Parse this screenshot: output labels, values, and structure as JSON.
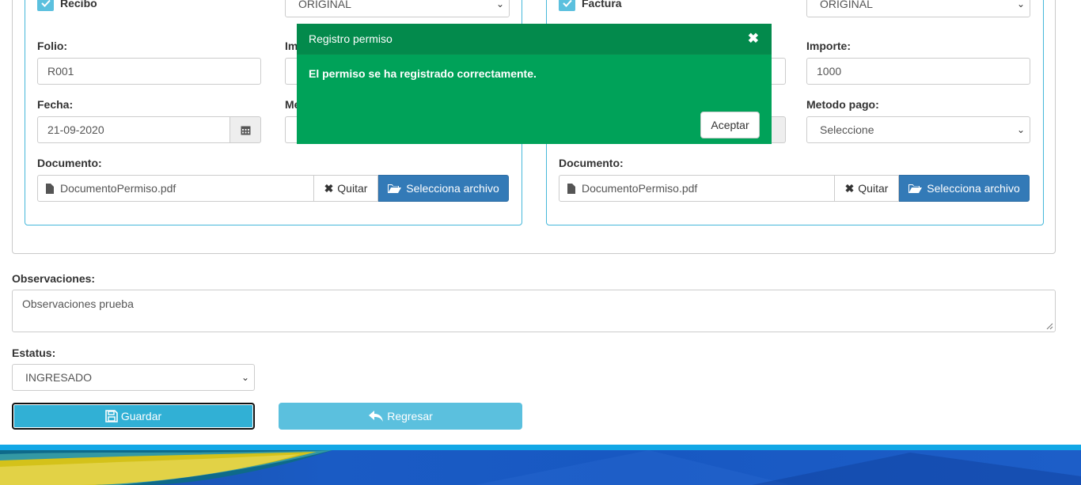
{
  "left_panel": {
    "checkbox_label": "Recibo",
    "type_select": "ORIGINAL",
    "folio_label": "Folio:",
    "folio_value": "R001",
    "importe_label_partial": "Im",
    "fecha_label": "Fecha:",
    "fecha_value": "21-09-2020",
    "metodo_label_partial": "Me",
    "documento_label": "Documento:",
    "file_name": "DocumentoPermiso.pdf",
    "remove_label": "Quitar",
    "select_file_label": "Selecciona archivo"
  },
  "right_panel": {
    "checkbox_label": "Factura",
    "type_select": "ORIGINAL",
    "importe_label": "Importe:",
    "importe_value": "1000",
    "metodo_label": "Metodo pago:",
    "metodo_value": "Seleccione",
    "documento_label": "Documento:",
    "file_name": "DocumentoPermiso.pdf",
    "remove_label": "Quitar",
    "select_file_label": "Selecciona archivo"
  },
  "observaciones": {
    "label": "Observaciones:",
    "value": "Observaciones prueba"
  },
  "estatus": {
    "label": "Estatus:",
    "value": "INGRESADO"
  },
  "actions": {
    "save_label": "Guardar",
    "back_label": "Regresar"
  },
  "modal": {
    "title": "Registro permiso",
    "message": "El permiso se ha registrado correctamente.",
    "ok_label": "Aceptar"
  },
  "colors": {
    "modal_green": "#00a259",
    "primary_blue": "#337ab7",
    "info_blue": "#5bc0de"
  }
}
